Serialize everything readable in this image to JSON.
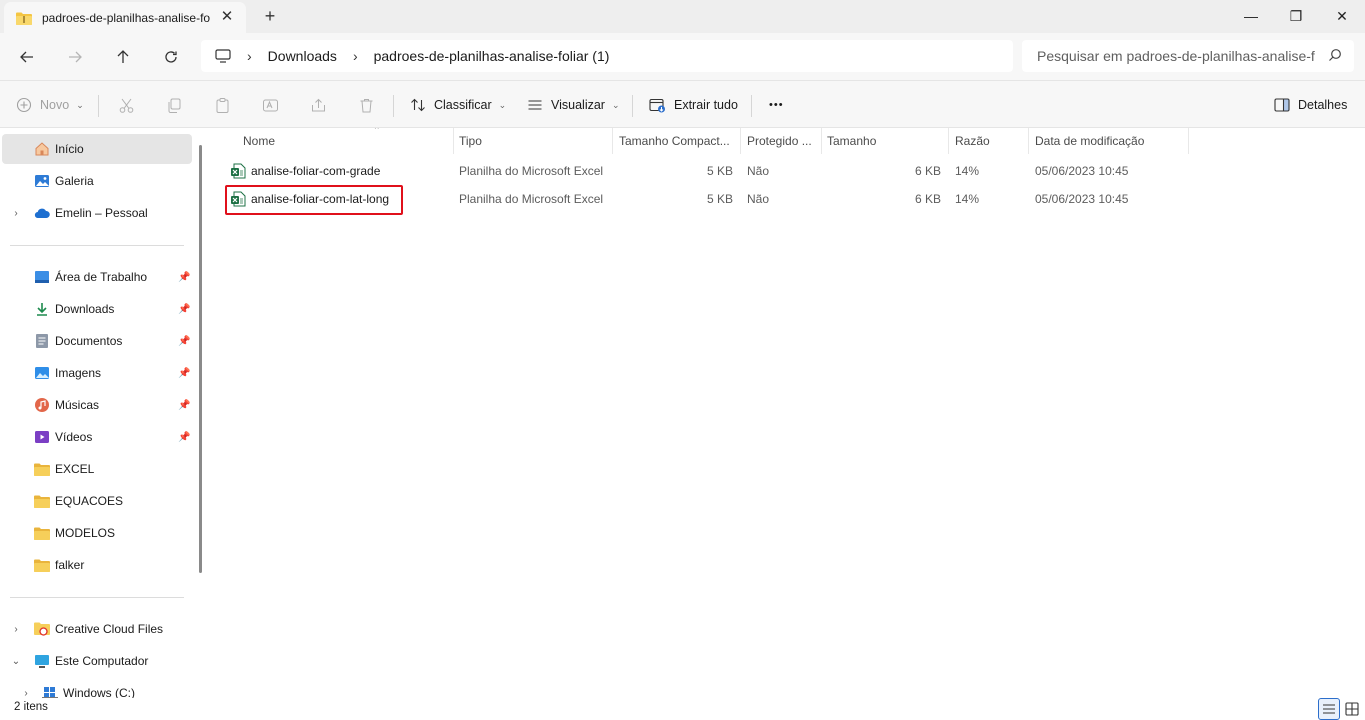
{
  "window": {
    "tab_title": "padroes-de-planilhas-analise-foliar (1)",
    "new_tab": "+",
    "minimize": "—",
    "maximize": "❐",
    "close": "✕"
  },
  "nav": {
    "breadcrumb": [
      "Downloads",
      "padroes-de-planilhas-analise-foliar (1)"
    ],
    "search_placeholder": "Pesquisar em padroes-de-planilhas-analise-f"
  },
  "toolbar": {
    "new_label": "Novo",
    "sort_label": "Classificar",
    "view_label": "Visualizar",
    "extract_label": "Extrair tudo",
    "more_label": "•••",
    "details_label": "Detalhes"
  },
  "sidebar": {
    "top_items": [
      {
        "label": "Início",
        "icon": "home-icon"
      },
      {
        "label": "Galeria",
        "icon": "gallery-icon"
      },
      {
        "label": "Emelin – Pessoal",
        "icon": "onedrive-icon"
      }
    ],
    "pinned_items": [
      {
        "label": "Área de Trabalho",
        "icon": "desktop-icon"
      },
      {
        "label": "Downloads",
        "icon": "download-icon"
      },
      {
        "label": "Documentos",
        "icon": "document-icon"
      },
      {
        "label": "Imagens",
        "icon": "image-icon"
      },
      {
        "label": "Músicas",
        "icon": "music-icon"
      },
      {
        "label": "Vídeos",
        "icon": "video-icon"
      },
      {
        "label": "EXCEL",
        "icon": "folder-icon"
      },
      {
        "label": "EQUACOES",
        "icon": "folder-icon"
      },
      {
        "label": "MODELOS",
        "icon": "folder-icon"
      },
      {
        "label": "falker",
        "icon": "folder-icon"
      }
    ],
    "bottom_items": [
      {
        "label": "Creative Cloud Files",
        "icon": "creative-cloud-icon"
      },
      {
        "label": "Este Computador",
        "icon": "computer-icon"
      },
      {
        "label": "Windows (C:)",
        "icon": "drive-icon"
      }
    ]
  },
  "columns": {
    "name": "Nome",
    "type": "Tipo",
    "compressed_size": "Tamanho Compact...",
    "protected": "Protegido ...",
    "size": "Tamanho",
    "ratio": "Razão",
    "modified": "Data de modificação"
  },
  "files": [
    {
      "name": "analise-foliar-com-grade",
      "type": "Planilha do Microsoft Excel",
      "compressed_size": "5 KB",
      "protected": "Não",
      "size": "6 KB",
      "ratio": "14%",
      "modified": "05/06/2023 10:45"
    },
    {
      "name": "analise-foliar-com-lat-long",
      "type": "Planilha do Microsoft Excel",
      "compressed_size": "5 KB",
      "protected": "Não",
      "size": "6 KB",
      "ratio": "14%",
      "modified": "05/06/2023 10:45"
    }
  ],
  "status": {
    "item_count": "2 itens"
  },
  "colors": {
    "highlight": "#e0101b",
    "accent": "#2c6ecb",
    "excel_green": "#1d7044",
    "folder_yellow": "#f4c542"
  }
}
